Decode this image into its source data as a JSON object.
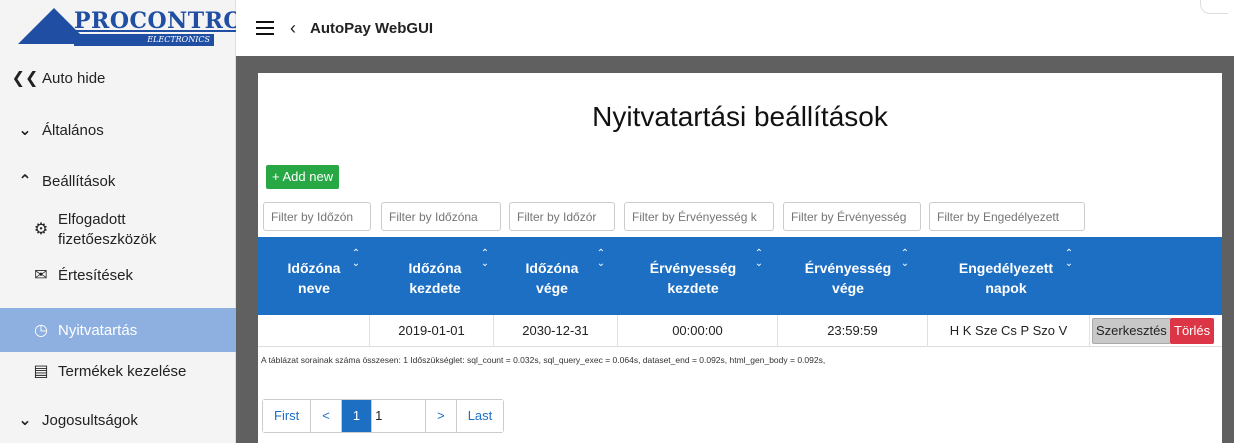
{
  "logo": {
    "name": "PROCONTROL",
    "sub": "ELECTRONICS"
  },
  "sidebar": {
    "items": [
      {
        "label": "Auto hide",
        "icon": "double-chevron-left-icon"
      },
      {
        "label": "Általános",
        "icon": "chevron-down-icon"
      },
      {
        "label": "Beállítások",
        "icon": "chevron-up-icon"
      },
      {
        "label": "Elfogadott fizetőeszközök",
        "icon": "gear-icon"
      },
      {
        "label": "Értesítések",
        "icon": "envelope-icon"
      },
      {
        "label": "Nyitvatartás",
        "icon": "clock-icon",
        "active": true
      },
      {
        "label": "Termékek kezelése",
        "icon": "document-icon"
      },
      {
        "label": "Jogosultságok",
        "icon": "chevron-down-icon"
      }
    ]
  },
  "topbar": {
    "title": "AutoPay WebGUI"
  },
  "main": {
    "title": "Nyitvatartási beállítások",
    "add_new": "+ Add new",
    "filters": [
      "Filter by Időzón",
      "Filter by Időzóna",
      "Filter by Időzór",
      "Filter by Érvényesség k",
      "Filter by Érvényesség",
      "Filter by Engedélyezett"
    ],
    "columns": [
      [
        "Időzóna",
        "neve"
      ],
      [
        "Időzóna",
        "kezdete"
      ],
      [
        "Időzóna",
        "vége"
      ],
      [
        "Érvényesség",
        "kezdete"
      ],
      [
        "Érvényesség",
        "vége"
      ],
      [
        "Engedélyezett",
        "napok"
      ]
    ],
    "rows": [
      [
        "",
        "2019-01-01",
        "2030-12-31",
        "00:00:00",
        "23:59:59",
        "H K Sze Cs P Szo V"
      ]
    ],
    "edit_label": "Szerkesztés",
    "delete_label": "Törlés",
    "footer_note": "A táblázat sorainak száma összesen: 1   Időszükséglet: sql_count = 0.032s, sql_query_exec = 0.064s, dataset_end = 0.092s, html_gen_body = 0.092s,",
    "pager": {
      "first": "First",
      "prev": "<",
      "current": "1",
      "input": "1",
      "next": ">",
      "last": "Last"
    }
  }
}
